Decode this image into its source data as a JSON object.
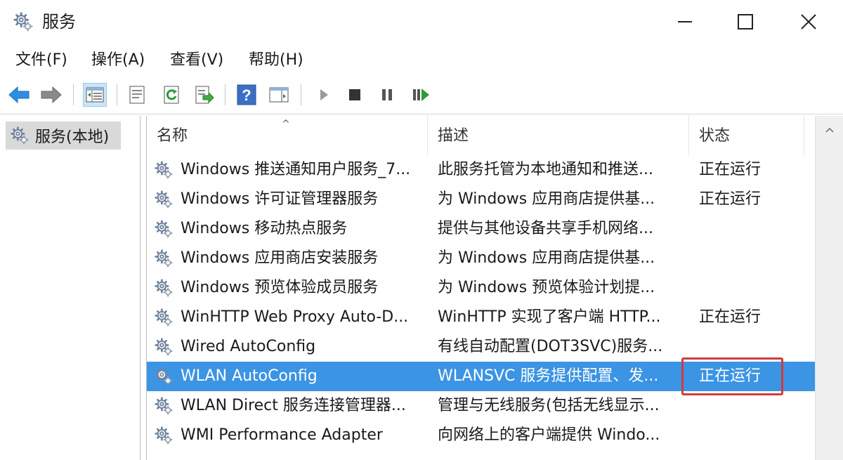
{
  "window": {
    "title": "服务",
    "icon": "gear-icon"
  },
  "menu": [
    "文件(F)",
    "操作(A)",
    "查看(V)",
    "帮助(H)"
  ],
  "tree": {
    "label": "服务(本地)",
    "icon": "gear-icon"
  },
  "columns": {
    "name": "名称",
    "description": "描述",
    "status": "状态"
  },
  "rows": [
    {
      "name": "Windows 推送通知用户服务_7...",
      "description": "此服务托管为本地通知和推送...",
      "status": "正在运行"
    },
    {
      "name": "Windows 许可证管理器服务",
      "description": "为 Windows 应用商店提供基...",
      "status": "正在运行"
    },
    {
      "name": "Windows 移动热点服务",
      "description": "提供与其他设备共享手机网络...",
      "status": ""
    },
    {
      "name": "Windows 应用商店安装服务",
      "description": "为 Windows 应用商店提供基...",
      "status": ""
    },
    {
      "name": "Windows 预览体验成员服务",
      "description": "为 Windows 预览体验计划提...",
      "status": ""
    },
    {
      "name": "WinHTTP Web Proxy Auto-D...",
      "description": "WinHTTP 实现了客户端 HTTP...",
      "status": "正在运行"
    },
    {
      "name": "Wired AutoConfig",
      "description": "有线自动配置(DOT3SVC)服务...",
      "status": ""
    },
    {
      "name": "WLAN AutoConfig",
      "description": "WLANSVC 服务提供配置、发...",
      "status": "正在运行"
    },
    {
      "name": "WLAN Direct 服务连接管理器...",
      "description": "管理与无线服务(包括无线显示...",
      "status": ""
    },
    {
      "name": "WMI Performance Adapter",
      "description": "向网络上的客户端提供 Windo...",
      "status": ""
    }
  ],
  "selected_row_index": 7,
  "colors": {
    "selection": "#3b94e4",
    "highlight_box": "#d23b3b"
  }
}
